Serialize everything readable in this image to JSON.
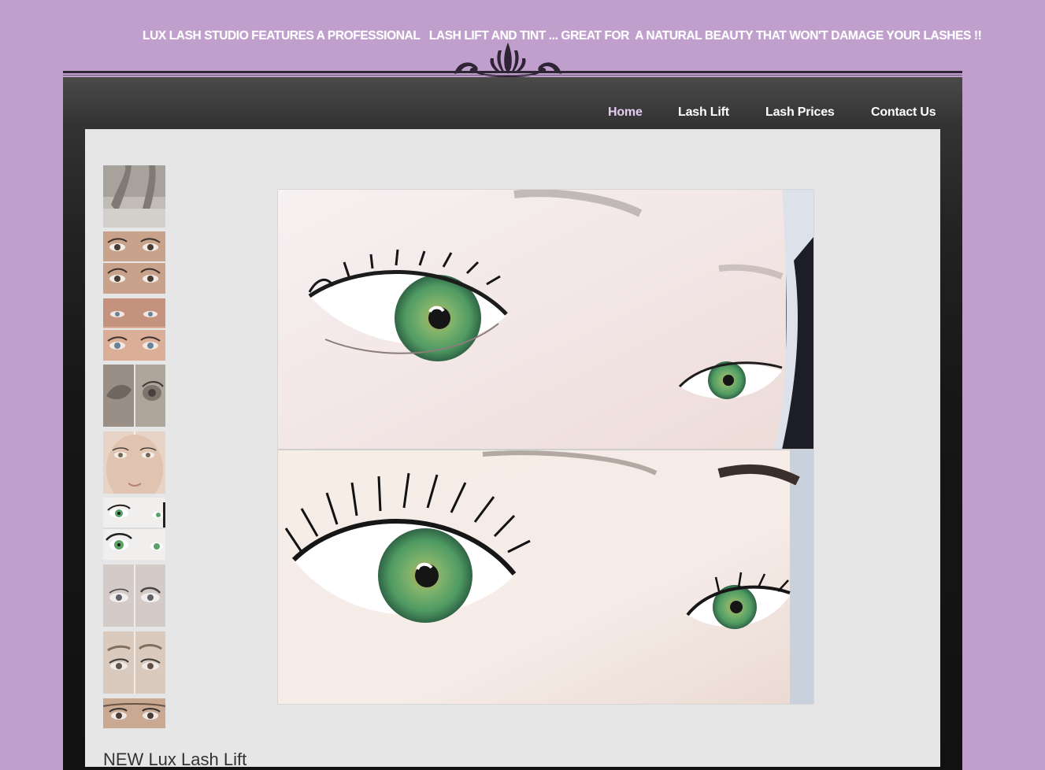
{
  "header": {
    "tagline": "LUX LASH STUDIO FEATURES A PROFESSIONAL   LASH LIFT AND TINT ... GREAT FOR  A NATURAL BEAUTY THAT WON'T DAMAGE YOUR LASHES !!"
  },
  "nav": {
    "items": [
      {
        "label": "Home",
        "active": true
      },
      {
        "label": "Lash Lift",
        "active": false
      },
      {
        "label": "Lash Prices",
        "active": false
      },
      {
        "label": "Contact Us",
        "active": false
      }
    ]
  },
  "gallery": {
    "thumbnail_count": 9,
    "selected_index": 5
  },
  "content": {
    "heading": "NEW Lux Lash Lift"
  },
  "colors": {
    "page_background": "#c09fcd",
    "frame_dark": "#111111",
    "content_background": "#e6e6e6",
    "nav_active": "#e4cdf0",
    "nav_text": "#ffffff",
    "iris_green": "#5aa267"
  }
}
